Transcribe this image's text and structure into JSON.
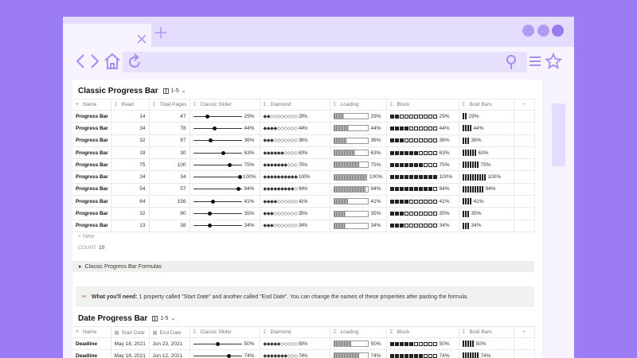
{
  "browser": {
    "tab_close_icon": "close-icon",
    "tab_add_icon": "plus-icon",
    "nav_icons": [
      "back-icon",
      "forward-icon",
      "home-icon",
      "reload-icon"
    ],
    "right_icons": [
      "location-pin-icon",
      "menu-icon",
      "star-icon"
    ],
    "colors": {
      "background": "#9b7cf2",
      "chrome": "#e4dcfd",
      "toolbar": "#f6f3ff"
    }
  },
  "classic": {
    "title": "Classic Progress Bar",
    "view_label": "1-5",
    "columns": [
      "Name",
      "Read",
      "Total Pages",
      "Classic Slider",
      "Diamond",
      "Loading",
      "Block",
      "Bold Bars",
      "+"
    ],
    "rows": [
      {
        "name": "Progress Bar",
        "read": "14",
        "total": "47",
        "slider": "29%",
        "diamond": "◆◆◇◇◇◇◇◇◇◇ 29%",
        "loading": "29%",
        "block": "29%",
        "bars": "29%",
        "p": 0.29
      },
      {
        "name": "Progress Bar",
        "read": "34",
        "total": "78",
        "slider": "44%",
        "diamond": "◆◆◆◆◇◇◇◇◇◇ 44%",
        "loading": "44%",
        "block": "44%",
        "bars": "44%",
        "p": 0.44
      },
      {
        "name": "Progress Bar",
        "read": "32",
        "total": "87",
        "slider": "36%",
        "diamond": "◆◆◆◇◇◇◇◇◇◇ 36%",
        "loading": "36%",
        "block": "36%",
        "bars": "36%",
        "p": 0.36
      },
      {
        "name": "Progress Bar",
        "read": "19",
        "total": "30",
        "slider": "63%",
        "diamond": "◆◆◆◆◆◆◇◇◇◇ 63%",
        "loading": "63%",
        "block": "63%",
        "bars": "63%",
        "p": 0.63
      },
      {
        "name": "Progress Bar",
        "read": "75",
        "total": "100",
        "slider": "75%",
        "diamond": "◆◆◆◆◆◆◆◇◇◇ 75%",
        "loading": "75%",
        "block": "75%",
        "bars": "75%",
        "p": 0.75
      },
      {
        "name": "Progress Bar",
        "read": "34",
        "total": "34",
        "slider": "100%",
        "diamond": "◆◆◆◆◆◆◆◆◆◆ 100%",
        "loading": "100%",
        "block": "100%",
        "bars": "100%",
        "p": 1.0
      },
      {
        "name": "Progress Bar",
        "read": "54",
        "total": "57",
        "slider": "94%",
        "diamond": "◆◆◆◆◆◆◆◆◆◇ 94%",
        "loading": "94%",
        "block": "94%",
        "bars": "94%",
        "p": 0.94
      },
      {
        "name": "Progress Bar",
        "read": "64",
        "total": "156",
        "slider": "41%",
        "diamond": "◆◆◆◆◇◇◇◇◇◇ 41%",
        "loading": "41%",
        "block": "41%",
        "bars": "41%",
        "p": 0.41
      },
      {
        "name": "Progress Bar",
        "read": "32",
        "total": "90",
        "slider": "35%",
        "diamond": "◆◆◆◇◇◇◇◇◇◇ 35%",
        "loading": "35%",
        "block": "35%",
        "bars": "35%",
        "p": 0.35
      },
      {
        "name": "Progress Bar",
        "read": "13",
        "total": "38",
        "slider": "34%",
        "diamond": "◆◆◆◇◇◇◇◇◇◇ 34%",
        "loading": "34%",
        "block": "34%",
        "bars": "34%",
        "p": 0.34
      }
    ],
    "new_label": "+ New",
    "count_label": "COUNT",
    "count_value": "10",
    "formulas_toggle": "Classic Progress Bar Formulas"
  },
  "callout": {
    "icon": "scissors-icon",
    "bold": "What you'll need:",
    "text": "1 property called \"Start Date\" and another called \"End Date\". You can change the names of these properties after pasting the formula."
  },
  "date": {
    "title": "Date Progress Bar",
    "view_label": "1-5",
    "columns": [
      "Name",
      "Start Date",
      "End Date",
      "Classic Slider",
      "Diamond",
      "Loading",
      "Block",
      "Bold Bars",
      "+"
    ],
    "rows": [
      {
        "name": "Deadline",
        "start": "May 18, 2021",
        "end": "Jun 23, 2021",
        "slider": "50%",
        "diamond": "◆◆◆◆◆◇◇◇◇◇ 50%",
        "loading": "50%",
        "block": "50%",
        "bars": "50%",
        "p": 0.5
      },
      {
        "name": "Deadline",
        "start": "May 18, 2021",
        "end": "Jun 12, 2021",
        "slider": "74%",
        "diamond": "◆◆◆◆◆◆◆◇◇◇ 74%",
        "loading": "74%",
        "block": "74%",
        "bars": "74%",
        "p": 0.74
      }
    ]
  }
}
